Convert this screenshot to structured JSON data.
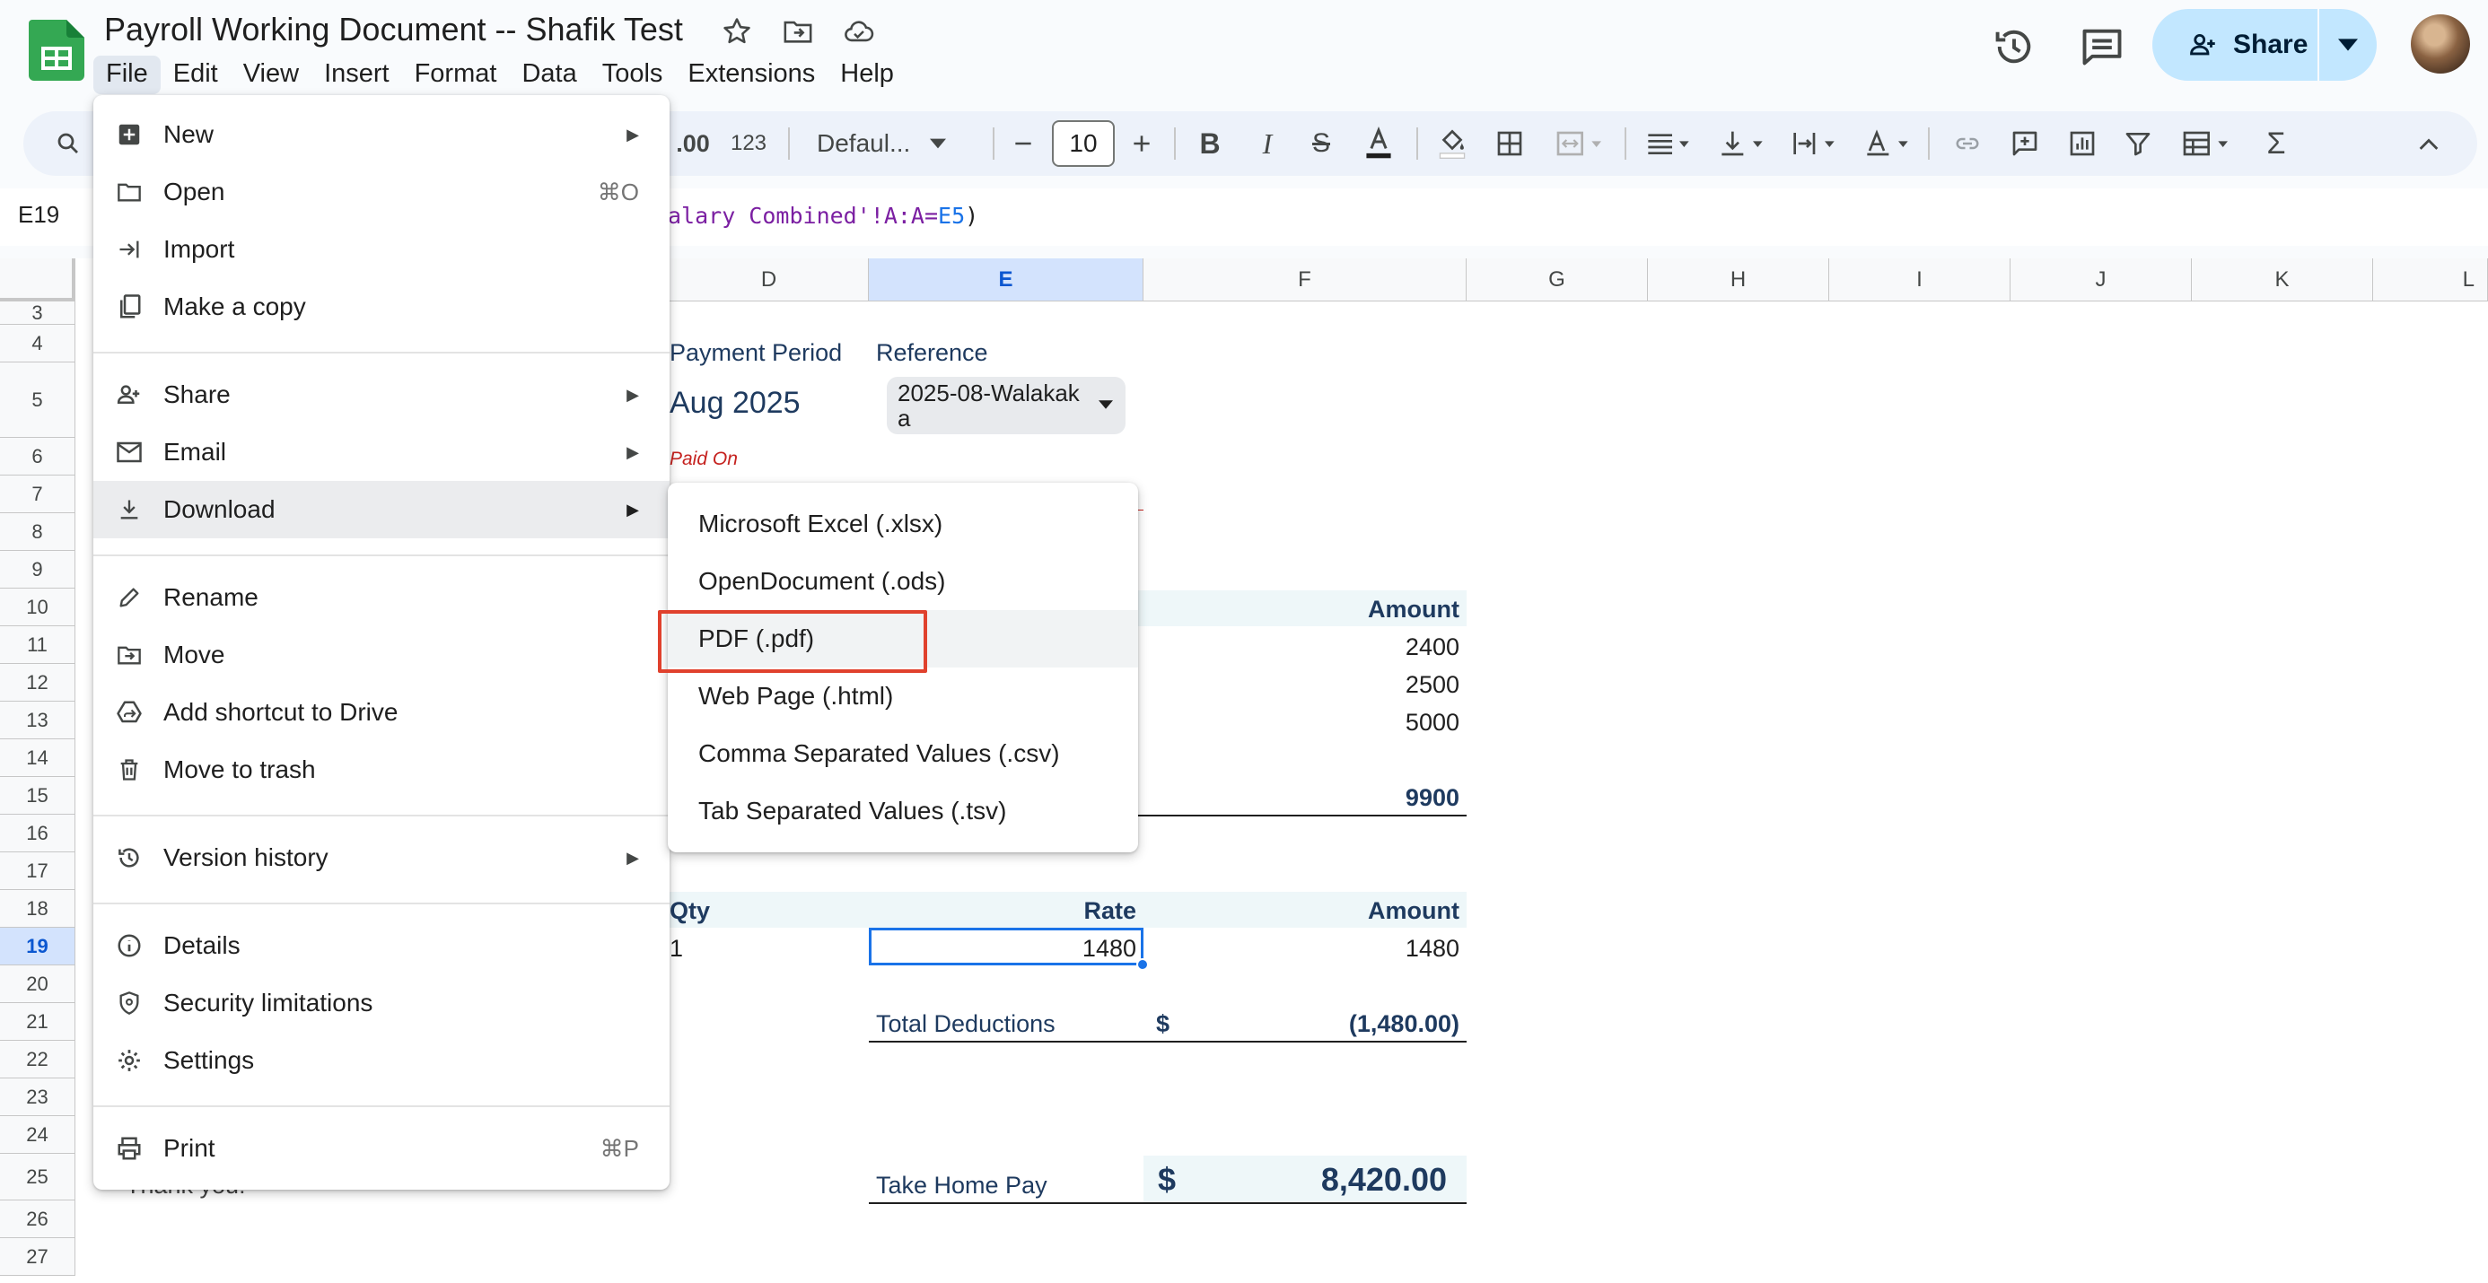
{
  "doc": {
    "title": "Payroll Working Document -- Shafik Test"
  },
  "menubar": [
    "File",
    "Edit",
    "View",
    "Insert",
    "Format",
    "Data",
    "Tools",
    "Extensions",
    "Help"
  ],
  "share": {
    "label": "Share"
  },
  "toolbar": {
    "decimal_label": ".00",
    "number_label": "123",
    "font": "Defaul...",
    "font_size": "10"
  },
  "formula": {
    "name_box": "E19",
    "text_part": "alary Combined'!A:A=",
    "ref": "E5",
    "close": ")"
  },
  "columns": [
    "D",
    "E",
    "F",
    "G",
    "H",
    "I",
    "J",
    "K",
    "L"
  ],
  "rows": [
    "3",
    "4",
    "5",
    "6",
    "7",
    "8",
    "9",
    "10",
    "11",
    "12",
    "13",
    "14",
    "15",
    "16",
    "17",
    "18",
    "19",
    "20",
    "21",
    "22",
    "23",
    "24",
    "25",
    "26",
    "27"
  ],
  "sheet": {
    "payment_period_label": "Payment Period",
    "reference_label": "Reference",
    "payment_period_value": "Aug 2025",
    "reference_value_line1": "2025-08-Walakak",
    "reference_value_line2": "a",
    "paid_on_label": "Paid On",
    "earnings_amount_header": "Amount",
    "earnings_values": [
      "2400",
      "2500",
      "5000"
    ],
    "earnings_total": "9900",
    "ded_qty_header": "Qty",
    "ded_rate_header": "Rate",
    "ded_amount_header": "Amount",
    "ded_qty": "1",
    "ded_rate": "1480",
    "ded_amount": "1480",
    "total_deductions_label": "Total Deductions",
    "total_deductions_currency": "$",
    "total_deductions_value": "(1,480.00)",
    "take_home_label": "Take Home Pay",
    "take_home_currency": "$",
    "take_home_value": "8,420.00",
    "thank_you": "Thank you!"
  },
  "file_menu": {
    "new": "New",
    "open": "Open",
    "open_shortcut": "⌘O",
    "import": "Import",
    "make_copy": "Make a copy",
    "share": "Share",
    "email": "Email",
    "download": "Download",
    "rename": "Rename",
    "move": "Move",
    "add_shortcut": "Add shortcut to Drive",
    "move_to_trash": "Move to trash",
    "version_history": "Version history",
    "details": "Details",
    "security": "Security limitations",
    "settings": "Settings",
    "print": "Print",
    "print_shortcut": "⌘P"
  },
  "download_menu": {
    "xlsx": "Microsoft Excel (.xlsx)",
    "ods": "OpenDocument (.ods)",
    "pdf": "PDF (.pdf)",
    "html": "Web Page (.html)",
    "csv": "Comma Separated Values (.csv)",
    "tsv": "Tab Separated Values (.tsv)"
  },
  "colors": {
    "accent": "#1a73e8",
    "highlight": "#e0412d",
    "share_bg": "#c2e7ff",
    "sheets_green": "#34a853"
  }
}
